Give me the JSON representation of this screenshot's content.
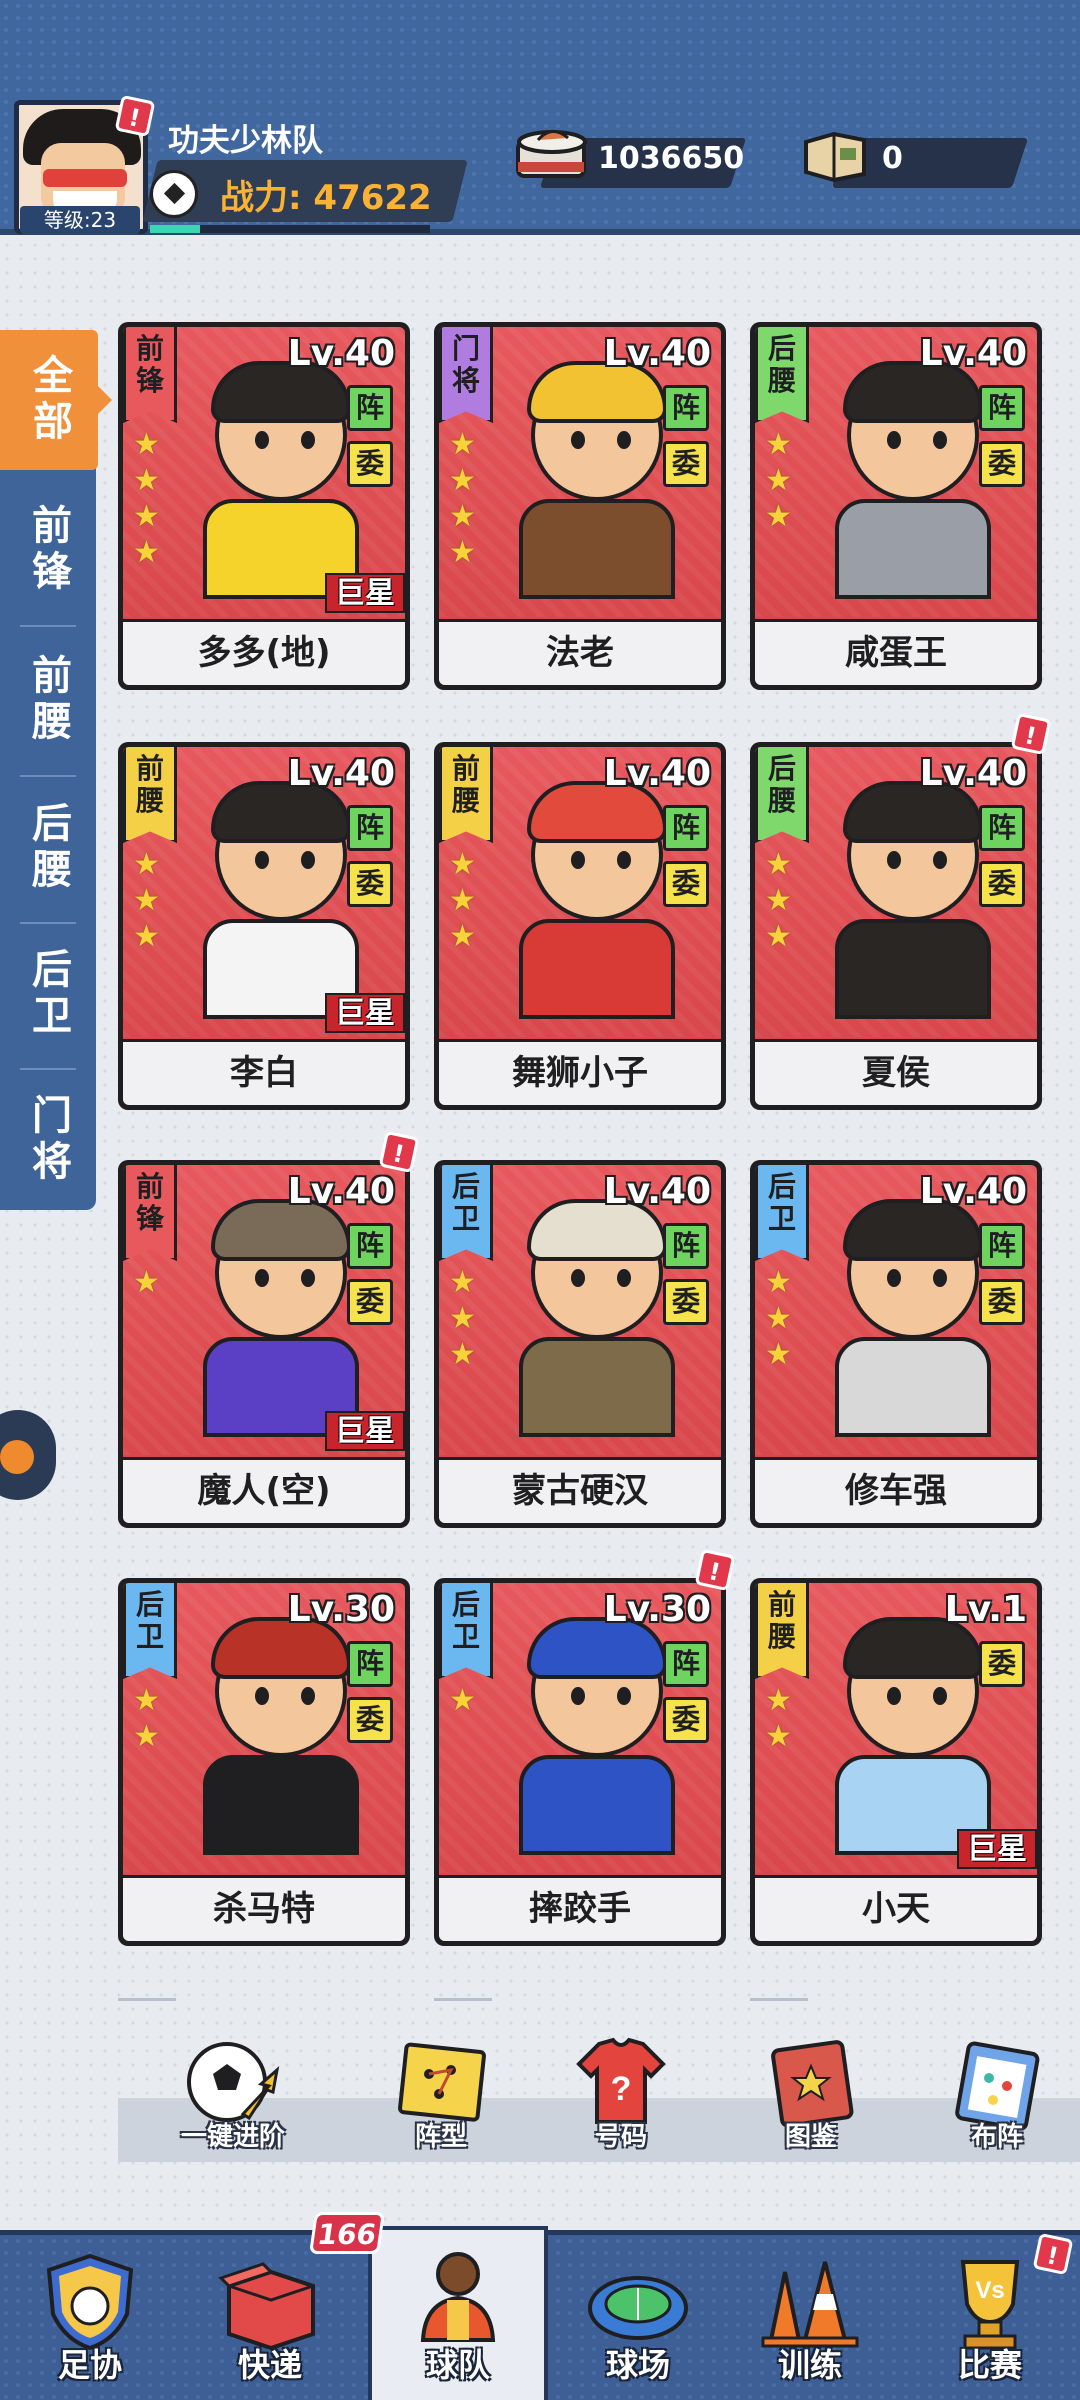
{
  "header": {
    "team_name": "功夫少林队",
    "level_label": "等级:23",
    "power_label": "战力: 47622",
    "power_progress": 0.18,
    "alert_mark": "!",
    "resources": [
      {
        "name": "food-bowl-icon",
        "value": "1036650"
      },
      {
        "name": "book-icon",
        "value": "0"
      }
    ]
  },
  "tabs": [
    {
      "label": "全部",
      "active": true
    },
    {
      "label": "前锋",
      "active": false
    },
    {
      "label": "前腰",
      "active": false
    },
    {
      "label": "后腰",
      "active": false
    },
    {
      "label": "后卫",
      "active": false
    },
    {
      "label": "门将",
      "active": false
    }
  ],
  "card_labels": {
    "zhen": "阵",
    "wei": "委",
    "superstar": "巨星",
    "alert": "!"
  },
  "players": [
    {
      "name": "多多(地)",
      "position": "前锋",
      "level": "Lv.40",
      "stars": 4,
      "zhen": true,
      "wei": true,
      "superstar": true,
      "alert": false,
      "pos_color": "#e8595e",
      "shirt": "#f5d32a",
      "hair": "#2a2624"
    },
    {
      "name": "法老",
      "position": "门将",
      "level": "Lv.40",
      "stars": 4,
      "zhen": true,
      "wei": true,
      "superstar": false,
      "alert": false,
      "pos_color": "#b07ce0",
      "shirt": "#7d4e2e",
      "hair": "#f2c233"
    },
    {
      "name": "咸蛋王",
      "position": "后腰",
      "level": "Lv.40",
      "stars": 3,
      "zhen": true,
      "wei": true,
      "superstar": false,
      "alert": false,
      "pos_color": "#7fd86b",
      "shirt": "#9a9ea6",
      "hair": "#2a2624"
    },
    {
      "name": "李白",
      "position": "前腰",
      "level": "Lv.40",
      "stars": 3,
      "zhen": true,
      "wei": true,
      "superstar": true,
      "alert": false,
      "pos_color": "#f4d046",
      "shirt": "#f4f4f4",
      "hair": "#2a2624"
    },
    {
      "name": "舞狮小子",
      "position": "前腰",
      "level": "Lv.40",
      "stars": 3,
      "zhen": true,
      "wei": true,
      "superstar": false,
      "alert": false,
      "pos_color": "#f4d046",
      "shirt": "#d83a35",
      "hair": "#e24a3b"
    },
    {
      "name": "夏侯",
      "position": "后腰",
      "level": "Lv.40",
      "stars": 3,
      "zhen": true,
      "wei": true,
      "superstar": false,
      "alert": true,
      "pos_color": "#7fd86b",
      "shirt": "#2a2624",
      "hair": "#2a2624"
    },
    {
      "name": "魔人(空)",
      "position": "前锋",
      "level": "Lv.40",
      "stars": 1,
      "zhen": true,
      "wei": true,
      "superstar": true,
      "alert": true,
      "pos_color": "#e8595e",
      "shirt": "#5b3fc4",
      "hair": "#7a6a58"
    },
    {
      "name": "蒙古硬汉",
      "position": "后卫",
      "level": "Lv.40",
      "stars": 3,
      "zhen": true,
      "wei": true,
      "superstar": false,
      "alert": false,
      "pos_color": "#6bb7ef",
      "shirt": "#7d6b4a",
      "hair": "#e5dfd0"
    },
    {
      "name": "修车强",
      "position": "后卫",
      "level": "Lv.40",
      "stars": 3,
      "zhen": true,
      "wei": true,
      "superstar": false,
      "alert": false,
      "pos_color": "#6bb7ef",
      "shirt": "#d8d8d8",
      "hair": "#2a2624"
    },
    {
      "name": "杀马特",
      "position": "后卫",
      "level": "Lv.30",
      "stars": 2,
      "zhen": true,
      "wei": true,
      "superstar": false,
      "alert": false,
      "pos_color": "#6bb7ef",
      "shirt": "#1f1f22",
      "hair": "#b83227"
    },
    {
      "name": "摔跤手",
      "position": "后卫",
      "level": "Lv.30",
      "stars": 1,
      "zhen": true,
      "wei": true,
      "superstar": false,
      "alert": true,
      "pos_color": "#6bb7ef",
      "shirt": "#2e53c4",
      "hair": "#2e53c4"
    },
    {
      "name": "小天",
      "position": "前腰",
      "level": "Lv.1",
      "stars": 2,
      "zhen": false,
      "wei": true,
      "superstar": true,
      "alert": false,
      "pos_color": "#f4d046",
      "shirt": "#a9d3f2",
      "hair": "#2a2624"
    }
  ],
  "actions": [
    {
      "name": "one-click-advance",
      "label": "一键进阶",
      "icon": "soccer-ball-arrow-icon"
    },
    {
      "name": "formation",
      "label": "阵型",
      "icon": "tactics-board-icon"
    },
    {
      "name": "jersey-number",
      "label": "号码",
      "icon": "jersey-question-icon"
    },
    {
      "name": "catalog",
      "label": "图鉴",
      "icon": "album-book-icon"
    },
    {
      "name": "lineup",
      "label": "布阵",
      "icon": "clipboard-icon"
    }
  ],
  "nav": [
    {
      "name": "association",
      "label": "足协",
      "icon": "shield-badge-icon",
      "active": false,
      "alert": false
    },
    {
      "name": "express",
      "label": "快递",
      "icon": "delivery-box-icon",
      "active": false,
      "alert": false,
      "count": "166"
    },
    {
      "name": "team",
      "label": "球队",
      "icon": "player-icon",
      "active": true,
      "alert": false
    },
    {
      "name": "stadium",
      "label": "球场",
      "icon": "stadium-icon",
      "active": false,
      "alert": false
    },
    {
      "name": "training",
      "label": "训练",
      "icon": "traffic-cone-icon",
      "active": false,
      "alert": false
    },
    {
      "name": "match",
      "label": "比赛",
      "icon": "trophy-vs-icon",
      "active": false,
      "alert": true
    }
  ],
  "colors": {
    "header_bg": "#41679f",
    "tab_active": "#f0903a",
    "card_red": "#d44347",
    "power_text": "#f9b233"
  }
}
